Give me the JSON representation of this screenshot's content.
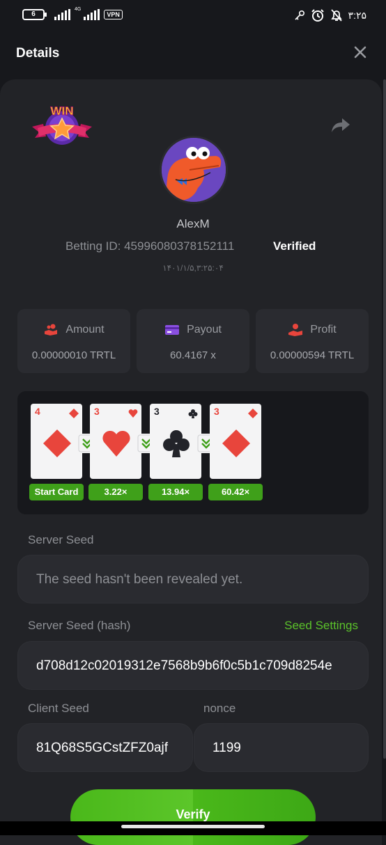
{
  "status_bar": {
    "battery": "6",
    "network_type": "4G",
    "vpn": "VPN",
    "time": "۳:۲۵",
    "icons": [
      "key-icon",
      "alarm-icon",
      "bell-off-icon"
    ]
  },
  "header": {
    "title": "Details",
    "close_icon": "close-icon"
  },
  "profile": {
    "badge": "WIN",
    "username": "AlexM",
    "betting_id": "Betting ID: 45996080378152111",
    "verified": "Verified",
    "datetime": "۱۴۰۱/۱/۵,۳:۲۵:۰۴"
  },
  "stats": [
    {
      "label": "Amount",
      "value": "0.00000010 TRTL",
      "icon": "coins-hand-icon"
    },
    {
      "label": "Payout",
      "value": "60.4167 x",
      "icon": "card-icon"
    },
    {
      "label": "Profit",
      "value": "0.00000594 TRTL",
      "icon": "profit-hand-icon"
    }
  ],
  "cards": [
    {
      "rank": "4",
      "suit": "diamond",
      "color": "#e8453c",
      "label": "Start Card"
    },
    {
      "rank": "3",
      "suit": "heart",
      "color": "#e8453c",
      "label": "3.22×"
    },
    {
      "rank": "3",
      "suit": "club",
      "color": "#23242a",
      "label": "13.94×"
    },
    {
      "rank": "3",
      "suit": "diamond",
      "color": "#e8453c",
      "label": "60.42×"
    }
  ],
  "seeds": {
    "server_seed_label": "Server Seed",
    "server_seed_value": "The seed hasn't been revealed yet.",
    "server_hash_label": "Server Seed (hash)",
    "seed_settings": "Seed Settings",
    "server_hash_value": "d708d12c02019312e7568b9b6f0c5b1c709d8254e",
    "client_seed_label": "Client Seed",
    "client_seed_value": "81Q68S5GCstZFZ0ajf",
    "nonce_label": "nonce",
    "nonce_value": "1199"
  },
  "verify_button": "Verify",
  "colors": {
    "accent": "#5bc22a",
    "background": "#17181c",
    "panel": "#222327",
    "box": "#2a2b30"
  }
}
